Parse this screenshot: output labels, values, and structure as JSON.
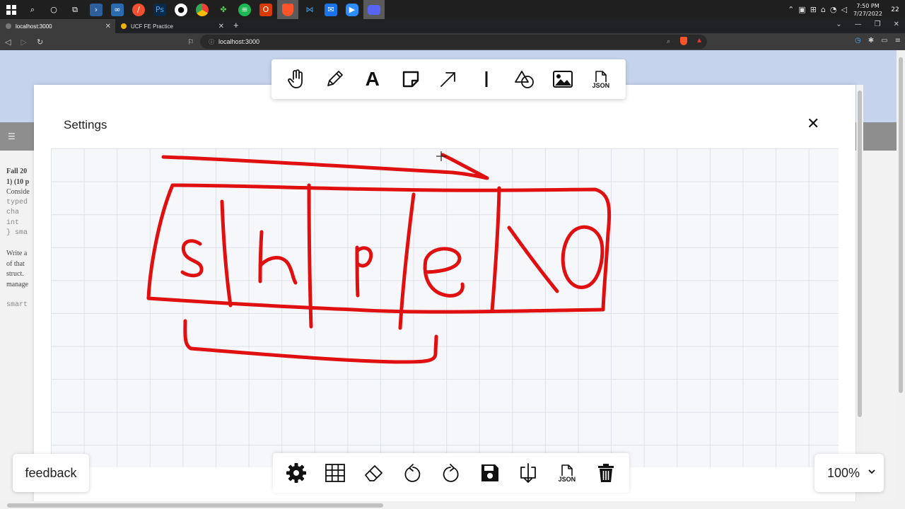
{
  "taskbar": {
    "icons": [
      "windows-start",
      "search",
      "cortana",
      "task-view",
      "powershell",
      "visual-studio",
      "git",
      "photoshop",
      "github-desktop",
      "chrome",
      "maple",
      "spotify",
      "office",
      "brave",
      "vscode",
      "mail",
      "zoom",
      "discord"
    ],
    "clock_time": "7:50 PM",
    "clock_date": "7/27/2022",
    "notification_count": "22"
  },
  "browser": {
    "tabs": [
      {
        "title": "localhost:3000",
        "active": true
      },
      {
        "title": "UCF FE Practice",
        "active": false
      }
    ],
    "url": "localhost:3000"
  },
  "behind_page": {
    "lines": [
      "Fall 20",
      "1) (10 p",
      "Conside",
      "typed",
      "  cha",
      "  int",
      "} sma",
      "",
      "Write a",
      "of that",
      "struct.",
      "manage",
      "",
      "smart"
    ]
  },
  "modal": {
    "title": "Settings"
  },
  "top_toolbar": {
    "tools": [
      {
        "name": "hand-tool",
        "icon": "hand-icon"
      },
      {
        "name": "pencil-tool",
        "icon": "pencil-icon"
      },
      {
        "name": "text-tool",
        "icon": "text-icon",
        "glyph": "A"
      },
      {
        "name": "sticky-note-tool",
        "icon": "sticky-note-icon"
      },
      {
        "name": "arrow-tool",
        "icon": "arrow-icon"
      },
      {
        "name": "line-tool",
        "icon": "line-icon"
      },
      {
        "name": "shapes-tool",
        "icon": "shapes-icon"
      },
      {
        "name": "image-tool",
        "icon": "image-icon"
      },
      {
        "name": "json-import-tool",
        "icon": "json-file-icon",
        "label": "JSON"
      }
    ]
  },
  "bottom_toolbar": {
    "tools": [
      {
        "name": "settings",
        "icon": "gear-icon"
      },
      {
        "name": "grid-toggle",
        "icon": "grid-icon"
      },
      {
        "name": "eraser",
        "icon": "eraser-icon"
      },
      {
        "name": "undo",
        "icon": "undo-icon"
      },
      {
        "name": "redo",
        "icon": "redo-icon"
      },
      {
        "name": "save",
        "icon": "save-icon"
      },
      {
        "name": "download",
        "icon": "download-icon"
      },
      {
        "name": "json-export",
        "icon": "json-file-icon",
        "label": "JSON"
      },
      {
        "name": "clear",
        "icon": "trash-icon"
      }
    ]
  },
  "feedback_label": "feedback",
  "zoom_level": "100%",
  "drawing": {
    "stroke_color": "#e01010",
    "characters": [
      "s",
      "h",
      "p",
      "e",
      "\\0"
    ]
  }
}
